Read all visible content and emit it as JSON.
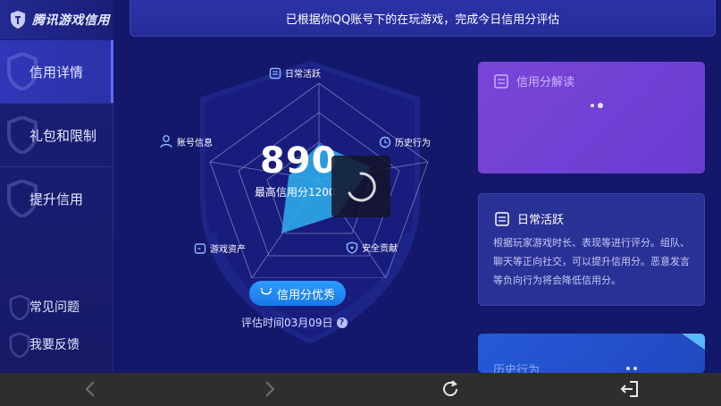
{
  "brand": {
    "name": "腾讯游戏信用",
    "icon": "shield-logo-icon"
  },
  "sidebar": {
    "items": [
      {
        "label": "信用详情",
        "active": true
      },
      {
        "label": "礼包和限制",
        "active": false
      },
      {
        "label": "提升信用",
        "active": false
      }
    ],
    "bottom_items": [
      {
        "label": "常见问题"
      },
      {
        "label": "我要反馈"
      }
    ]
  },
  "banner": {
    "text": "已根据你QQ账号下的在玩游戏，完成今日信用分评估"
  },
  "radar": {
    "axes": [
      {
        "label": "日常活跃",
        "icon": "document-icon"
      },
      {
        "label": "历史行为",
        "icon": "clock-icon"
      },
      {
        "label": "安全贡献",
        "icon": "shield-icon"
      },
      {
        "label": "游戏资产",
        "icon": "wallet-icon"
      },
      {
        "label": "账号信息",
        "icon": "user-icon"
      }
    ],
    "score": "890",
    "max_label": "最高信用分1200",
    "rating_button": "信用分优秀",
    "eval_time": "评估时间03月09日"
  },
  "cards": [
    {
      "title": "信用分解读",
      "icon": "document-icon",
      "state": "loading"
    },
    {
      "title": "日常活跃",
      "icon": "document-icon",
      "body": "根据玩家游戏时长、表现等进行评分。组队、聊天等正向社交，可以提升信用分。恶意发言等负向行为将会降低信用分。"
    },
    {
      "title": "历史行为",
      "icon": "document-icon",
      "state": "loading"
    }
  ],
  "bottom_bar": {
    "back_icon": "chevron-left-icon",
    "forward_icon": "chevron-right-icon",
    "refresh_icon": "refresh-icon",
    "exit_icon": "exit-icon"
  },
  "colors": {
    "background": "#13186a",
    "accent": "#1779e8",
    "card_purple": "#7a44d8",
    "radar_fill": "#2fb0f0"
  }
}
